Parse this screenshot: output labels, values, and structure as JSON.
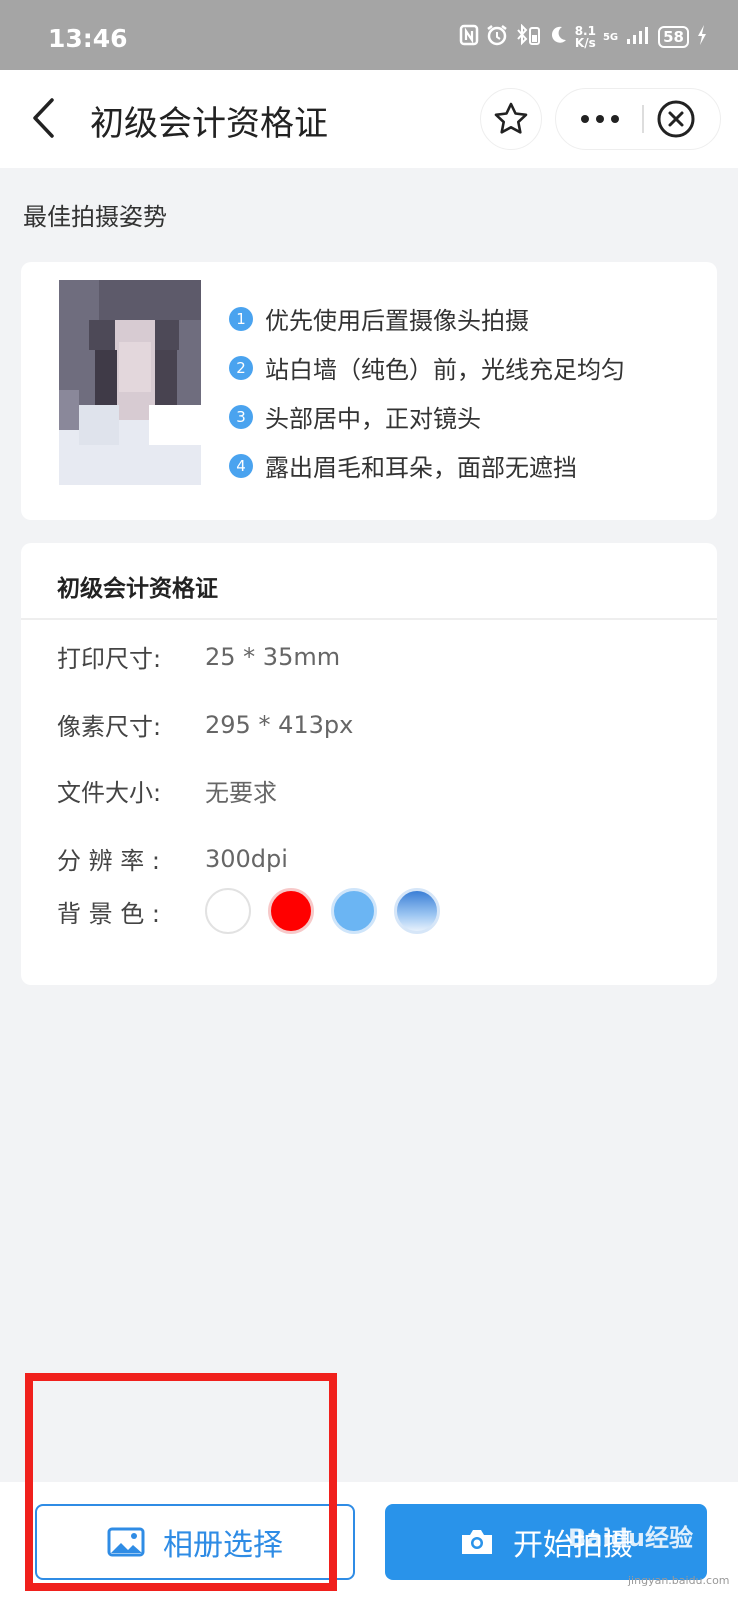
{
  "status_bar": {
    "time": "13:46",
    "net_speed_value": "8.1",
    "net_speed_unit": "K/s",
    "signal_text": "5G",
    "battery": "58"
  },
  "nav": {
    "title": "初级会计资格证"
  },
  "pose_section": {
    "title": "最佳拍摄姿势"
  },
  "tips": [
    {
      "num": "1",
      "text": "优先使用后置摄像头拍摄"
    },
    {
      "num": "2",
      "text": "站白墙（纯色）前，光线充足均匀"
    },
    {
      "num": "3",
      "text": "头部居中，正对镜头"
    },
    {
      "num": "4",
      "text": "露出眉毛和耳朵，面部无遮挡"
    }
  ],
  "spec": {
    "title": "初级会计资格证",
    "rows": [
      {
        "label": "打印尺寸:",
        "value": "25 * 35mm"
      },
      {
        "label": "像素尺寸:",
        "value": "295 * 413px"
      },
      {
        "label": "文件大小:",
        "value": "无要求"
      },
      {
        "label": "分 辨 率 :",
        "value": "300dpi"
      }
    ],
    "bg_label": "背 景 色 :",
    "bg_colors": [
      "#ffffff",
      "#ff0000",
      "#6bb5f3",
      "gradient-blue"
    ]
  },
  "bottom": {
    "album_label": "相册选择",
    "shoot_label": "开始拍摄"
  },
  "watermark": {
    "brand": "Baidu经验",
    "sub": "jingyan.baidu.com"
  },
  "colors": {
    "accent": "#2993ea",
    "highlight": "#f0201c"
  }
}
